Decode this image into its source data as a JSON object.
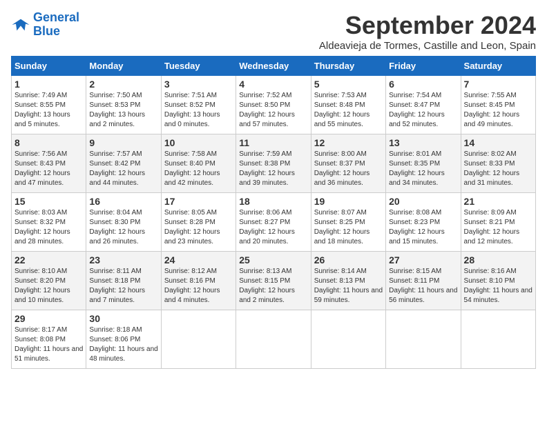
{
  "header": {
    "logo_line1": "General",
    "logo_line2": "Blue",
    "month_title": "September 2024",
    "subtitle": "Aldeavieja de Tormes, Castille and Leon, Spain"
  },
  "weekdays": [
    "Sunday",
    "Monday",
    "Tuesday",
    "Wednesday",
    "Thursday",
    "Friday",
    "Saturday"
  ],
  "weeks": [
    [
      {
        "day": "1",
        "sunrise": "7:49 AM",
        "sunset": "8:55 PM",
        "daylight": "13 hours and 5 minutes."
      },
      {
        "day": "2",
        "sunrise": "7:50 AM",
        "sunset": "8:53 PM",
        "daylight": "13 hours and 2 minutes."
      },
      {
        "day": "3",
        "sunrise": "7:51 AM",
        "sunset": "8:52 PM",
        "daylight": "13 hours and 0 minutes."
      },
      {
        "day": "4",
        "sunrise": "7:52 AM",
        "sunset": "8:50 PM",
        "daylight": "12 hours and 57 minutes."
      },
      {
        "day": "5",
        "sunrise": "7:53 AM",
        "sunset": "8:48 PM",
        "daylight": "12 hours and 55 minutes."
      },
      {
        "day": "6",
        "sunrise": "7:54 AM",
        "sunset": "8:47 PM",
        "daylight": "12 hours and 52 minutes."
      },
      {
        "day": "7",
        "sunrise": "7:55 AM",
        "sunset": "8:45 PM",
        "daylight": "12 hours and 49 minutes."
      }
    ],
    [
      {
        "day": "8",
        "sunrise": "7:56 AM",
        "sunset": "8:43 PM",
        "daylight": "12 hours and 47 minutes."
      },
      {
        "day": "9",
        "sunrise": "7:57 AM",
        "sunset": "8:42 PM",
        "daylight": "12 hours and 44 minutes."
      },
      {
        "day": "10",
        "sunrise": "7:58 AM",
        "sunset": "8:40 PM",
        "daylight": "12 hours and 42 minutes."
      },
      {
        "day": "11",
        "sunrise": "7:59 AM",
        "sunset": "8:38 PM",
        "daylight": "12 hours and 39 minutes."
      },
      {
        "day": "12",
        "sunrise": "8:00 AM",
        "sunset": "8:37 PM",
        "daylight": "12 hours and 36 minutes."
      },
      {
        "day": "13",
        "sunrise": "8:01 AM",
        "sunset": "8:35 PM",
        "daylight": "12 hours and 34 minutes."
      },
      {
        "day": "14",
        "sunrise": "8:02 AM",
        "sunset": "8:33 PM",
        "daylight": "12 hours and 31 minutes."
      }
    ],
    [
      {
        "day": "15",
        "sunrise": "8:03 AM",
        "sunset": "8:32 PM",
        "daylight": "12 hours and 28 minutes."
      },
      {
        "day": "16",
        "sunrise": "8:04 AM",
        "sunset": "8:30 PM",
        "daylight": "12 hours and 26 minutes."
      },
      {
        "day": "17",
        "sunrise": "8:05 AM",
        "sunset": "8:28 PM",
        "daylight": "12 hours and 23 minutes."
      },
      {
        "day": "18",
        "sunrise": "8:06 AM",
        "sunset": "8:27 PM",
        "daylight": "12 hours and 20 minutes."
      },
      {
        "day": "19",
        "sunrise": "8:07 AM",
        "sunset": "8:25 PM",
        "daylight": "12 hours and 18 minutes."
      },
      {
        "day": "20",
        "sunrise": "8:08 AM",
        "sunset": "8:23 PM",
        "daylight": "12 hours and 15 minutes."
      },
      {
        "day": "21",
        "sunrise": "8:09 AM",
        "sunset": "8:21 PM",
        "daylight": "12 hours and 12 minutes."
      }
    ],
    [
      {
        "day": "22",
        "sunrise": "8:10 AM",
        "sunset": "8:20 PM",
        "daylight": "12 hours and 10 minutes."
      },
      {
        "day": "23",
        "sunrise": "8:11 AM",
        "sunset": "8:18 PM",
        "daylight": "12 hours and 7 minutes."
      },
      {
        "day": "24",
        "sunrise": "8:12 AM",
        "sunset": "8:16 PM",
        "daylight": "12 hours and 4 minutes."
      },
      {
        "day": "25",
        "sunrise": "8:13 AM",
        "sunset": "8:15 PM",
        "daylight": "12 hours and 2 minutes."
      },
      {
        "day": "26",
        "sunrise": "8:14 AM",
        "sunset": "8:13 PM",
        "daylight": "11 hours and 59 minutes."
      },
      {
        "day": "27",
        "sunrise": "8:15 AM",
        "sunset": "8:11 PM",
        "daylight": "11 hours and 56 minutes."
      },
      {
        "day": "28",
        "sunrise": "8:16 AM",
        "sunset": "8:10 PM",
        "daylight": "11 hours and 54 minutes."
      }
    ],
    [
      {
        "day": "29",
        "sunrise": "8:17 AM",
        "sunset": "8:08 PM",
        "daylight": "11 hours and 51 minutes."
      },
      {
        "day": "30",
        "sunrise": "8:18 AM",
        "sunset": "8:06 PM",
        "daylight": "11 hours and 48 minutes."
      },
      null,
      null,
      null,
      null,
      null
    ]
  ],
  "labels": {
    "sunrise": "Sunrise:",
    "sunset": "Sunset:",
    "daylight": "Daylight:"
  }
}
